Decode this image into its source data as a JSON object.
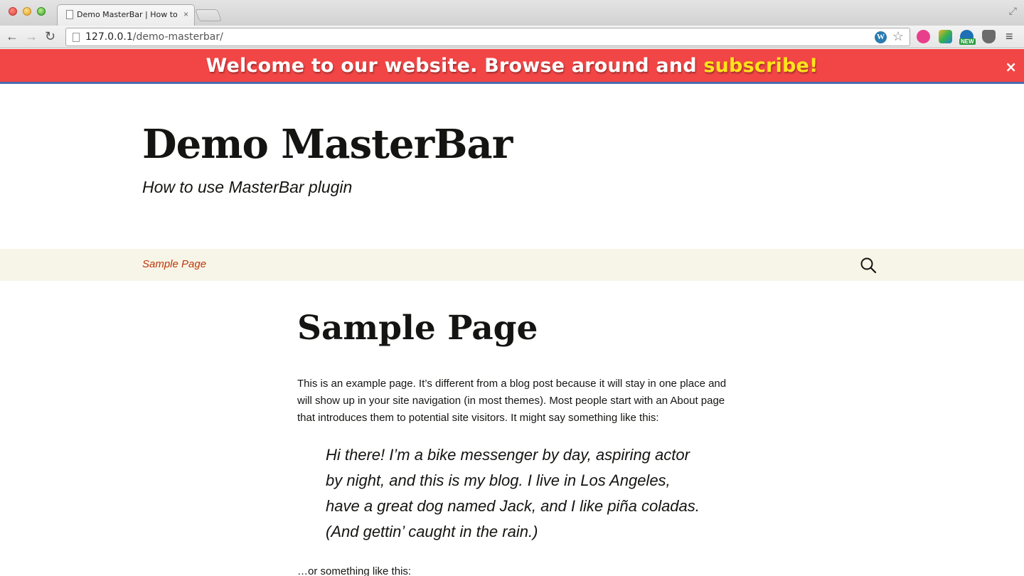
{
  "browser": {
    "tab_title": "Demo MasterBar | How to use MasterBar plugin",
    "tab_close": "×",
    "url_host": "127.0.0.1",
    "url_path": "/demo-masterbar/",
    "back_icon": "←",
    "forward_icon": "→",
    "reload_icon": "↻",
    "star_icon": "☆",
    "menu_icon": "≡",
    "extension_badge": "NEW"
  },
  "masterbar": {
    "text": "Welcome to our website. Browse around and ",
    "link_text": "subscribe!",
    "close_label": "×",
    "background": "#f24545",
    "link_color": "#ffe31a"
  },
  "site": {
    "title": "Demo MasterBar",
    "tagline": "How to use MasterBar plugin"
  },
  "nav": {
    "items": [
      {
        "label": "Sample Page"
      }
    ]
  },
  "page": {
    "title": "Sample Page",
    "intro": "This is an example page. It’s different from a blog post because it will stay in one place and will show up in your site navigation (in most themes). Most people start with an About page that introduces them to potential site visitors. It might say something like this:",
    "quote": "Hi there! I’m a bike messenger by day, aspiring actor by night, and this is my blog. I live in Los Angeles, have a great dog named Jack, and I like piña coladas. (And gettin’ caught in the rain.)",
    "after_quote": "…or something like this:"
  }
}
